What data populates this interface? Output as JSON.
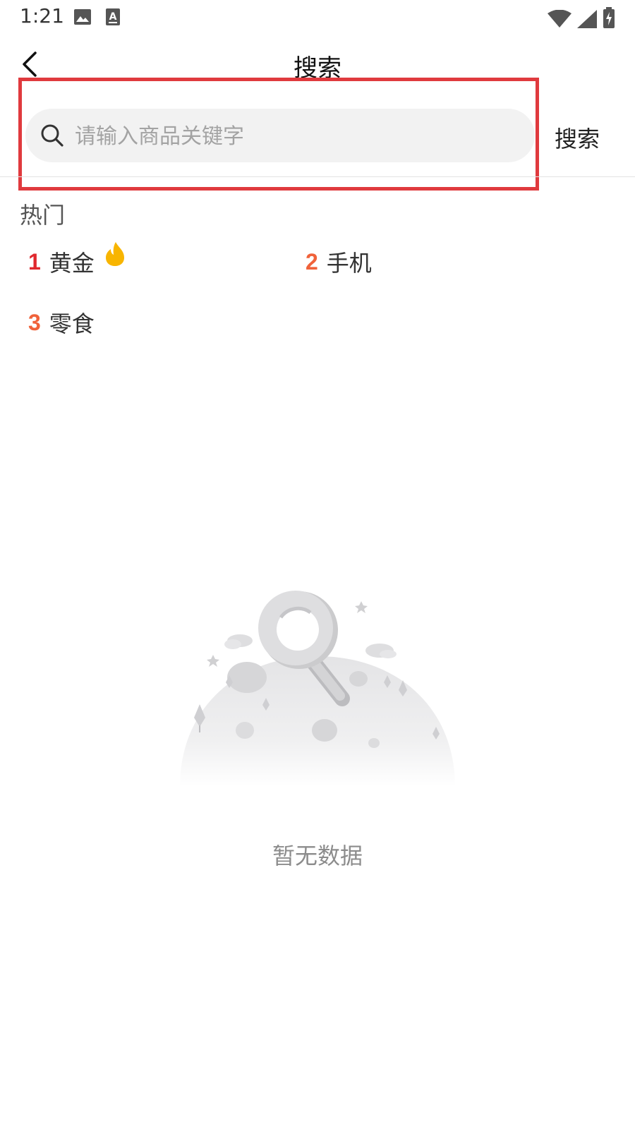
{
  "status_bar": {
    "time": "1:21",
    "icons": [
      "image-icon",
      "a-notification-icon",
      "wifi-icon",
      "cellular-signal-icon",
      "battery-charging-icon"
    ]
  },
  "nav": {
    "title": "搜索",
    "back_icon": "chevron-left-icon"
  },
  "search": {
    "placeholder": "请输入商品关键字",
    "value": "",
    "button_label": "搜索",
    "icon": "search-icon",
    "highlight_color": "#e03a3e"
  },
  "hot": {
    "title": "热门",
    "items": [
      {
        "rank": "1",
        "label": "黄金",
        "rank_color": "#e0282e",
        "badge": "fire-icon"
      },
      {
        "rank": "2",
        "label": "手机",
        "rank_color": "#f0623a"
      },
      {
        "rank": "3",
        "label": "零食",
        "rank_color": "#f0623a"
      }
    ]
  },
  "empty_state": {
    "illustration": "magnifier-on-planet-illustration",
    "text": "暂无数据"
  }
}
